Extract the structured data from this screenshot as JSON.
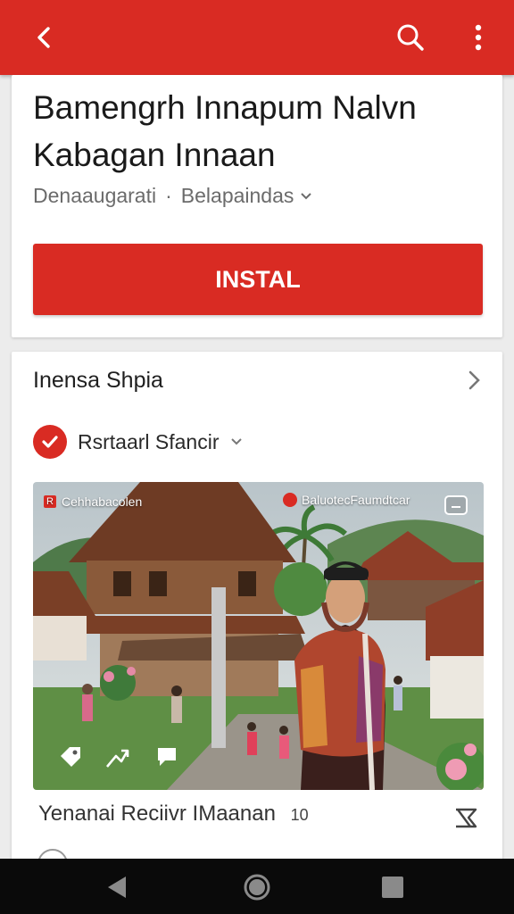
{
  "appbar": {
    "back_icon": "back-arrow-icon",
    "search_icon": "search-icon",
    "more_icon": "more-vert-icon",
    "color": "#d92b23"
  },
  "app": {
    "title": "Bamengrh Innapum Nalvn Kabagan Innaan",
    "developer": "Denaaugarati",
    "separator": "·",
    "category": "Belapaindas",
    "install_label": "INSTAL"
  },
  "section": {
    "title": "Inensa Shpia",
    "filter_label": "Rsrtaarl Sfancir",
    "screenshot": {
      "tag_badge": "R",
      "tag_text": "Cehhabacolen",
      "brand_text": "BaluotecFaumdtcar",
      "overlay_icons": [
        "tag-icon",
        "share-icon",
        "message-icon",
        "caption-icon"
      ]
    },
    "review": {
      "text": "Yenanai Reciivr IMaanan",
      "count": "10"
    }
  },
  "navbar": {
    "back": "nav-back-icon",
    "home": "nav-home-icon",
    "recents": "nav-recents-icon"
  }
}
